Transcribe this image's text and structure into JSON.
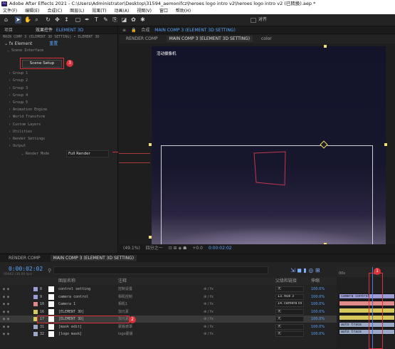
{
  "title": "Adobe After Effects 2021 - C:\\Users\\Administrator\\Desktop\\31594_aemonifcz\\heroes logo intro v2\\heroes logo intro v2 (已转换).aep *",
  "menu": [
    "文件(F)",
    "编辑(E)",
    "合成(C)",
    "图层(L)",
    "效果(T)",
    "动画(A)",
    "视图(V)",
    "窗口",
    "帮助(H)"
  ],
  "toolbar": {
    "align_label": "对齐"
  },
  "effects_panel": {
    "tab_project": "项目",
    "tab_effects": "效果控件",
    "tab_layer": "ELEMENT 3D",
    "breadcrumb": "MAIN COMP 3 (ELEMENT 3D SETTING) • ELEMENT 3D",
    "fx_name": "Element",
    "reset_label": "重置",
    "scene_interface": "Scene Interface",
    "scene_setup_button": "Scene Setup",
    "groups": [
      "Group 1",
      "Group 2",
      "Group 3",
      "Group 4",
      "Group 5",
      "Animation Engine",
      "World Transform",
      "Custom Layers",
      "Utilities",
      "Render Settings",
      "Output"
    ],
    "render_mode_label": "Render Mode",
    "render_mode_value": "Full Render",
    "badge_3": "3"
  },
  "comp_panel": {
    "tab_label": "合成",
    "tab_comp": "MAIN COMP 3 (ELEMENT 3D SETTING)",
    "subtabs": [
      "RENDER COMP",
      "MAIN COMP 3 (ELEMENT 3D SETTING)",
      "color"
    ],
    "camera_label": "活动摄像机",
    "zoom": "(49.1%)",
    "resolution": "四分之一",
    "exposure": "+0.0",
    "time": "0:00:02:02"
  },
  "timeline": {
    "tabs": [
      "RENDER COMP",
      "MAIN COMP 3 (ELEMENT 3D SETTING)"
    ],
    "timecode": "0:00:02:02",
    "timecode_sub": "00062 (30.00 fps)",
    "col_source": "图层名称",
    "col_comment": "注释",
    "col_parent": "父级和链接",
    "col_stretch": "伸缩",
    "badge_1": "1",
    "badge_2": "2",
    "ruler_start": "00s",
    "ruler_mark": "02s",
    "layers": [
      {
        "num": "8",
        "name": "control setting",
        "comment": "控制设置",
        "parent": "无",
        "stretch": "100.0%",
        "color": "#9b9bd6"
      },
      {
        "num": "9",
        "name": "camera control",
        "comment": "相机控制",
        "parent": "13. Null 3",
        "stretch": "100.0%",
        "color": "#9b9bd6"
      },
      {
        "num": "10",
        "name": "Camera 1",
        "comment": "相机1",
        "parent": "14. camera co",
        "stretch": "100.0%",
        "color": "#e08a8a"
      },
      {
        "num": "16",
        "name": "[ELEMENT 3D]",
        "comment": "加元素",
        "parent": "无",
        "stretch": "100.0%",
        "color": "#d6c85a"
      },
      {
        "num": "17",
        "name": "[ELEMENT 3D]",
        "comment": "加元素",
        "parent": "无",
        "stretch": "100.0%",
        "color": "#d6c85a"
      },
      {
        "num": "31",
        "name": "[mask edit]",
        "comment": "蒙版遮罩",
        "parent": "无",
        "stretch": "100.0%",
        "color": "#9aa9c8"
      },
      {
        "num": "32",
        "name": "[logo mask]",
        "comment": "logo蒙版",
        "parent": "无",
        "stretch": "100.0%",
        "color": "#9aa9c8"
      }
    ],
    "bar_labels": [
      "camera control",
      "auto trace",
      "auto trace"
    ]
  },
  "colors": {
    "accent": "#5aa7ff",
    "highlight_red": "#d9323a",
    "handle_yellow": "#f0e070"
  }
}
